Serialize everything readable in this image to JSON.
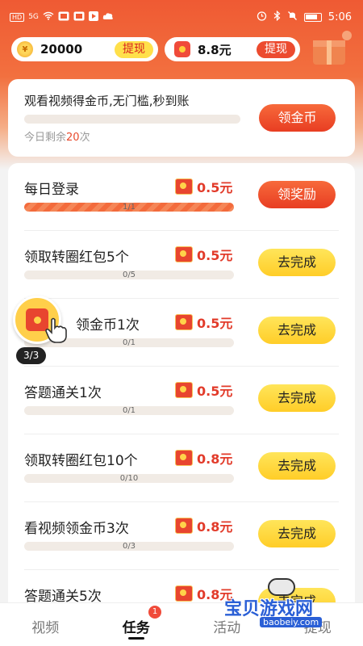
{
  "status_bar": {
    "time": "5:06",
    "left_icons": [
      "HD",
      "5G"
    ]
  },
  "balance": {
    "coins": "20000",
    "coin_withdraw_label": "提现",
    "coin_icon_text": "¥",
    "cash": "8.8元",
    "cash_withdraw_label": "提现"
  },
  "video_card": {
    "title": "观看视频得金币,无门槛,秒到账",
    "remain_prefix": "今日剩余",
    "remain_count": "20",
    "remain_suffix": "次",
    "button_label": "领金币"
  },
  "tasks": [
    {
      "name": "每日登录",
      "reward": "0.5元",
      "progress": "1/1",
      "progress_ratio": 1,
      "button": "领奖励",
      "button_style": "red"
    },
    {
      "name": "领取转圈红包5个",
      "reward": "0.5元",
      "progress": "0/5",
      "progress_ratio": 0,
      "button": "去完成",
      "button_style": "yellow"
    },
    {
      "name": "领金币1次",
      "reward": "0.5元",
      "progress": "0/1",
      "progress_ratio": 0,
      "button": "去完成",
      "button_style": "yellow"
    },
    {
      "name": "答题通关1次",
      "reward": "0.5元",
      "progress": "0/1",
      "progress_ratio": 0,
      "button": "去完成",
      "button_style": "yellow"
    },
    {
      "name": "领取转圈红包10个",
      "reward": "0.8元",
      "progress": "0/10",
      "progress_ratio": 0,
      "button": "去完成",
      "button_style": "yellow"
    },
    {
      "name": "看视频领金币3次",
      "reward": "0.8元",
      "progress": "0/3",
      "progress_ratio": 0,
      "button": "去完成",
      "button_style": "yellow"
    },
    {
      "name": "答题通关5次",
      "reward": "0.8元",
      "progress": "",
      "progress_ratio": 0,
      "button": "去完成",
      "button_style": "yellow"
    }
  ],
  "floating_widget": {
    "counter": "3/3"
  },
  "bottom_nav": {
    "items": [
      {
        "label": "视频",
        "active": false
      },
      {
        "label": "任务",
        "active": true
      },
      {
        "label": "活动",
        "active": false
      },
      {
        "label": "提现",
        "active": false
      }
    ],
    "task_badge": "1"
  },
  "watermark": {
    "title": "宝贝游戏网",
    "url": "baobeiy.com"
  },
  "colors": {
    "accent_red": "#e83d22",
    "accent_yellow": "#ffcd28",
    "header_orange": "#ef5a33"
  }
}
